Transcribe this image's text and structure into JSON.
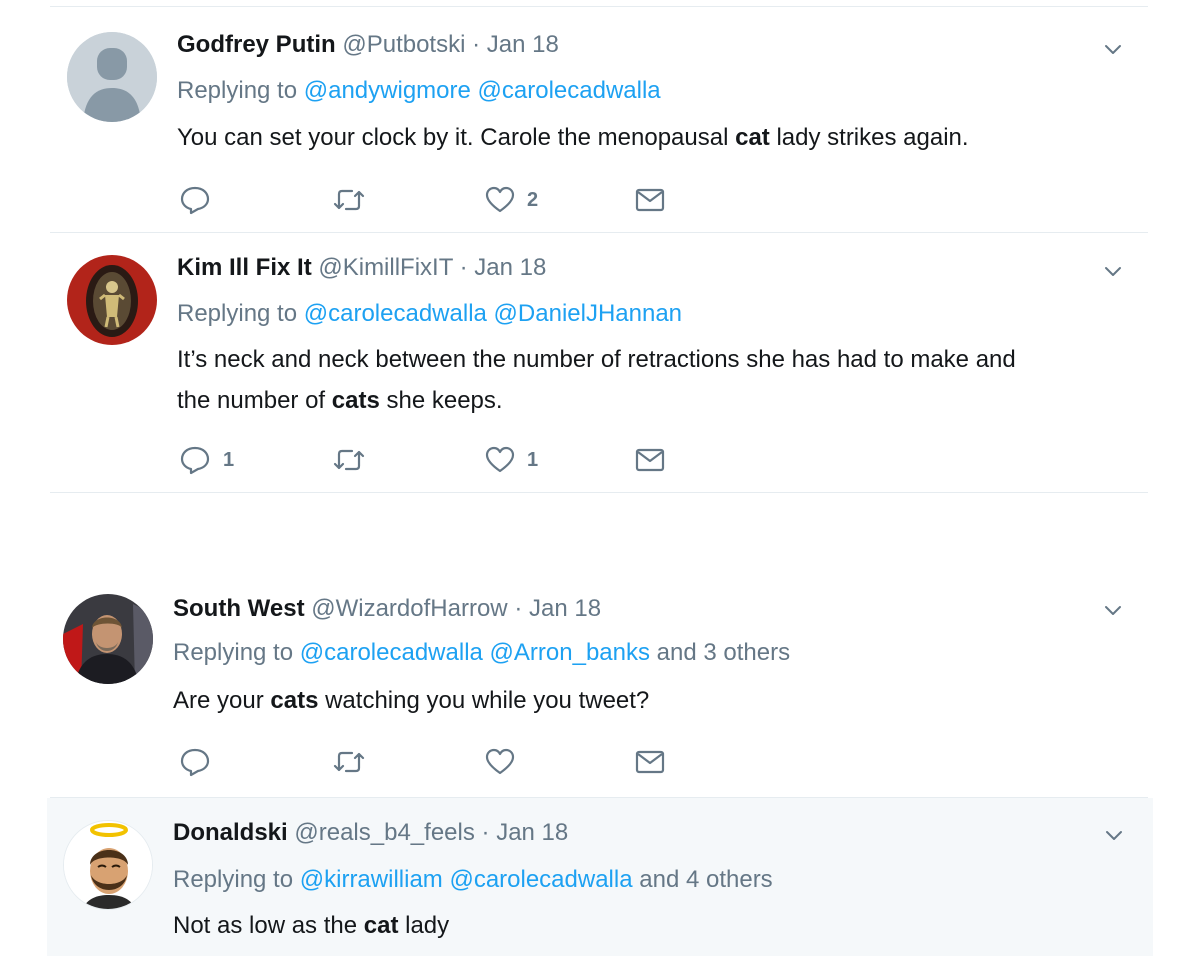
{
  "tweets": [
    {
      "name": "Godfrey Putin",
      "handle": "@Putbotski",
      "separator": "·",
      "date": "Jan 18",
      "replying_prefix": "Replying to",
      "mentions": [
        "@andywigmore",
        "@carolecadwalla"
      ],
      "others": "",
      "text_parts": [
        "You can set your clock by it. Carole the menopausal ",
        "cat",
        " lady strikes again."
      ],
      "text_line2": [
        "",
        "",
        ""
      ],
      "replies": "",
      "retweets": "",
      "likes": "2"
    },
    {
      "name": "Kim Ill Fix It",
      "handle": "@KimillFixIT",
      "separator": "·",
      "date": "Jan 18",
      "replying_prefix": "Replying to",
      "mentions": [
        "@carolecadwalla",
        "@DanielJHannan"
      ],
      "others": "",
      "text_parts": [
        "It’s neck and neck between the number of retractions she has had to make and",
        "",
        ""
      ],
      "text_line2": [
        "the number of ",
        "cats",
        " she keeps."
      ],
      "replies": "1",
      "retweets": "",
      "likes": "1"
    },
    {
      "name": "South West",
      "handle": "@WizardofHarrow",
      "separator": "·",
      "date": "Jan 18",
      "replying_prefix": "Replying to",
      "mentions": [
        "@carolecadwalla",
        "@Arron_banks"
      ],
      "others": "and 3 others",
      "text_parts": [
        "Are your ",
        "cats",
        " watching you while you tweet?"
      ],
      "text_line2": [
        "",
        "",
        ""
      ],
      "replies": "",
      "retweets": "",
      "likes": ""
    },
    {
      "name": "Donaldski",
      "handle": "@reals_b4_feels",
      "separator": "·",
      "date": "Jan 18",
      "replying_prefix": "Replying to",
      "mentions": [
        "@kirrawilliam",
        "@carolecadwalla"
      ],
      "others": "and 4 others",
      "text_parts": [
        "Not as low as the ",
        "cat",
        " lady"
      ],
      "text_line2": [
        "",
        "",
        ""
      ],
      "replies": "",
      "retweets": "",
      "likes": ""
    }
  ],
  "icons": {
    "reply": "reply-icon",
    "retweet": "retweet-icon",
    "like": "heart-icon",
    "dm": "envelope-icon",
    "caret": "chevron-down-icon"
  },
  "colors": {
    "mention": "#1da1f2",
    "muted": "#657786",
    "divider": "#e6ecf0",
    "highlight_bg": "#f5f8fa"
  }
}
